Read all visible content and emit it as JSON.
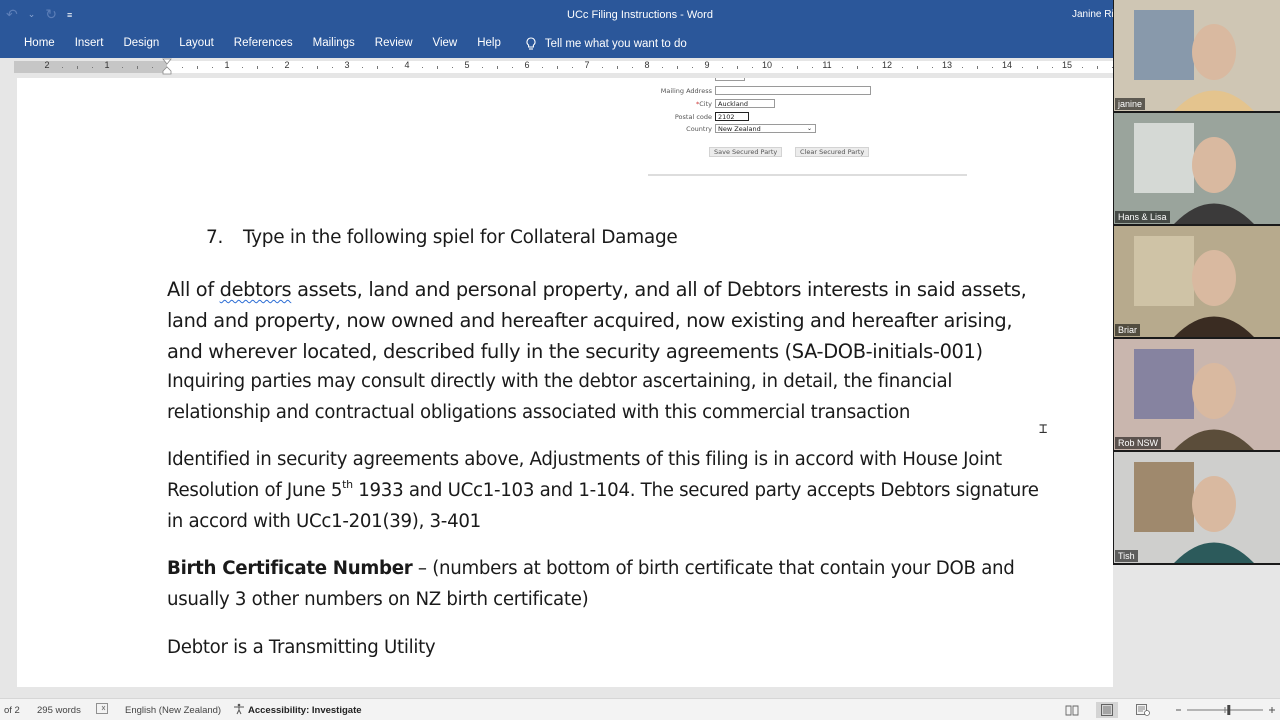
{
  "app": {
    "document_title": "UCc Filing Instructions  -  Word",
    "user_name": "Janine Rich"
  },
  "ribbon": {
    "tabs": [
      "Home",
      "Insert",
      "Design",
      "Layout",
      "References",
      "Mailings",
      "Review",
      "View",
      "Help"
    ],
    "tell_me": "Tell me what you want to do"
  },
  "ruler": {
    "left_labels": [
      "2",
      "1"
    ],
    "right_labels": [
      "1",
      "2",
      "3",
      "4",
      "5",
      "6",
      "7",
      "8",
      "9",
      "10",
      "11",
      "12",
      "13",
      "14",
      "15"
    ]
  },
  "embedded_form": {
    "mailing_address_label": "Mailing Address",
    "mailing_address_value": "",
    "city_required_marker": "*",
    "city_label": "City",
    "city_value": "Auckland",
    "postal_code_label": "Postal code",
    "postal_code_value": "2102",
    "country_label": "Country",
    "country_value": "New Zealand",
    "save_button": "Save Secured Party",
    "clear_button": "Clear Secured Party"
  },
  "document": {
    "step_number": "7.",
    "step_text": "Type in the following spiel for Collateral Damage",
    "para1": {
      "line1_pre": "All of ",
      "line1_flagged": "debtors",
      "line1_post": " assets, land and personal property, and all of Debtors interests in said assets,",
      "line2": "land and property, now owned and hereafter acquired, now existing and hereafter arising,",
      "line3": "and wherever located, described fully in the security agreements (SA-DOB-initials-001)",
      "line4": "Inquiring parties may consult directly with the debtor ascertaining, in detail, the financial",
      "line5": "relationship and contractual obligations associated with this commercial transaction"
    },
    "para2": {
      "line1": "Identified in security agreements above, Adjustments of this filing is in accord with House Joint",
      "line2_pre": "Resolution of June 5",
      "line2_sup": "th",
      "line2_post": " 1933 and UCc1-103 and 1-104.  The secured party accepts Debtors signature",
      "line3": "in accord with UCc1-201(39), 3-401"
    },
    "para3": {
      "bold": "Birth Certificate Number",
      "line1_rest": " – (numbers at bottom of birth certificate that contain your DOB and",
      "line2": "usually 3 other numbers on NZ birth certificate)"
    },
    "para4": "Debtor is a Transmitting Utility"
  },
  "statusbar": {
    "page": "of 2",
    "words": "295 words",
    "language": "English (New Zealand)",
    "accessibility": "Accessibility: Investigate",
    "zoom_fraction": 0.55
  },
  "video_gallery": {
    "participants": [
      {
        "name": "janine",
        "colors": [
          "#cfc6b4",
          "#6a86a6",
          "#e4c48e"
        ]
      },
      {
        "name": "Hans & Lisa",
        "colors": [
          "#9aa49c",
          "#eef0ee",
          "#3b3a3a"
        ]
      },
      {
        "name": "Briar",
        "colors": [
          "#b7aa8d",
          "#d9cdb0",
          "#3a2c22"
        ]
      },
      {
        "name": "Rob NSW",
        "colors": [
          "#c9b6ae",
          "#6a6e9a",
          "#5b4d3a"
        ]
      },
      {
        "name": "Tish",
        "colors": [
          "#cfcfcd",
          "#8a6b45",
          "#2c5a5b"
        ]
      }
    ]
  }
}
